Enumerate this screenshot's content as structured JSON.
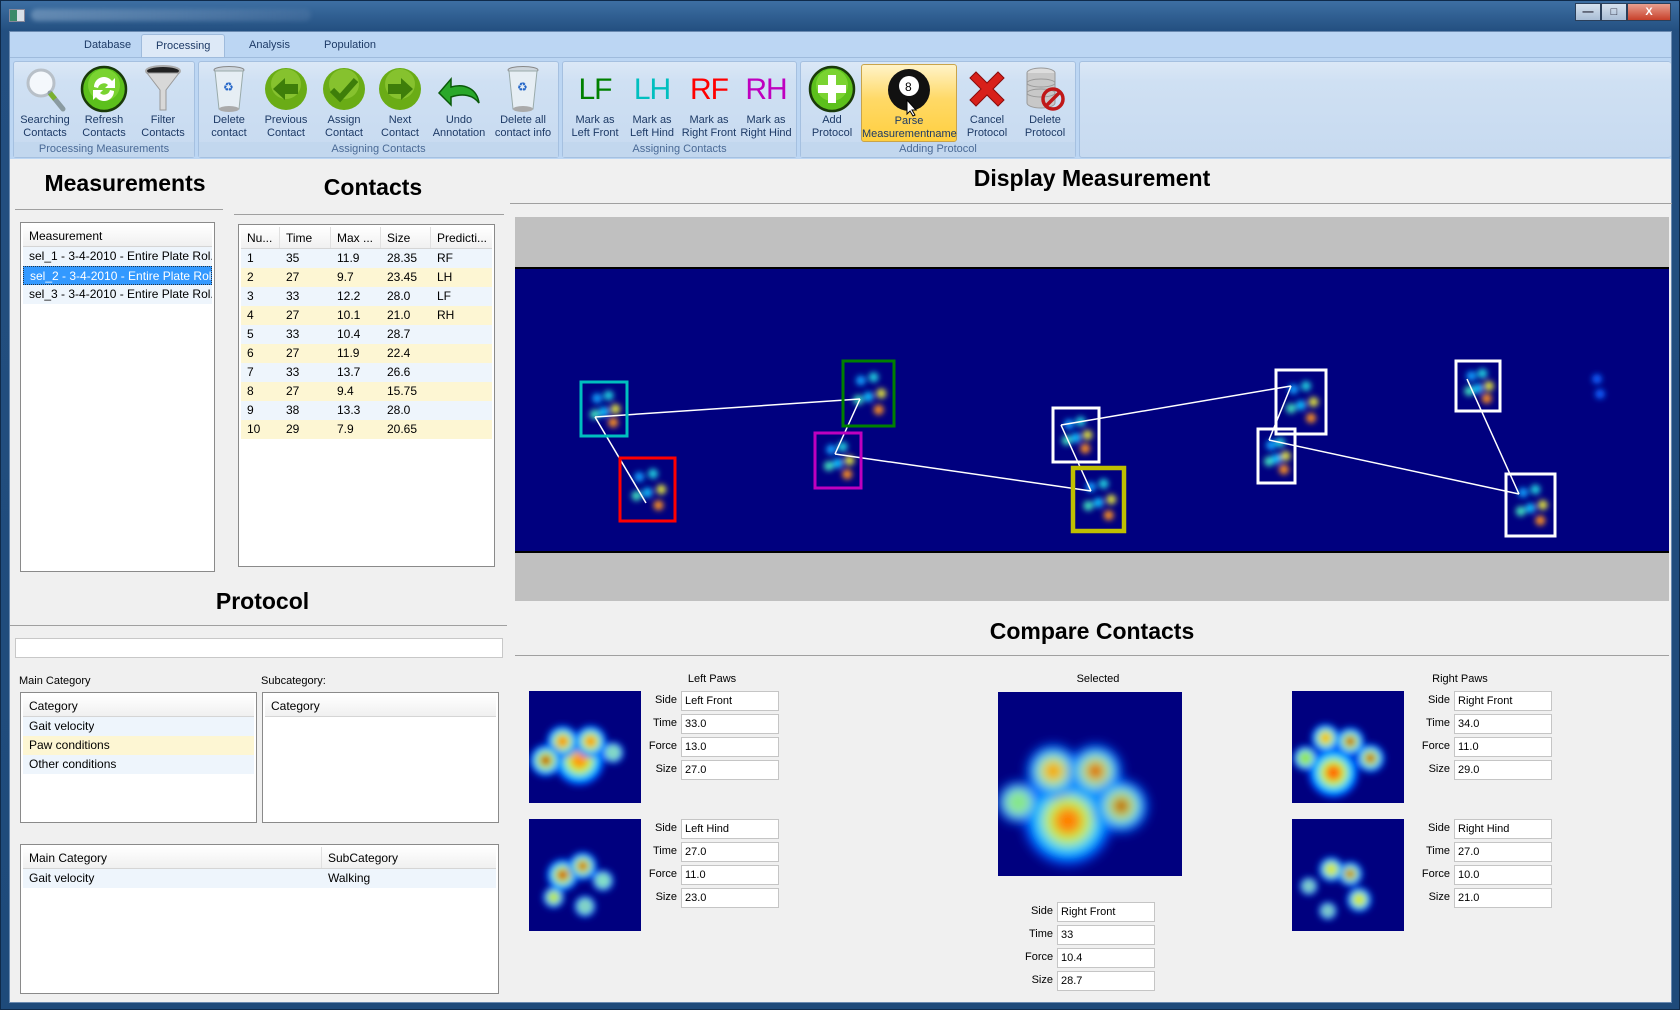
{
  "window": {
    "controls": {
      "minimize": "—",
      "maximize": "□",
      "close": "X"
    }
  },
  "tabs": [
    {
      "label": "Database",
      "active": false
    },
    {
      "label": "Processing",
      "active": true
    },
    {
      "label": "Analysis",
      "active": false
    },
    {
      "label": "Population",
      "active": false
    }
  ],
  "ribbon": {
    "groups": [
      {
        "label": "Processing Measurements",
        "buttons": [
          {
            "label1": "Searching",
            "label2": "Contacts",
            "icon": "search-icon"
          },
          {
            "label1": "Refresh",
            "label2": "Contacts",
            "icon": "refresh-icon"
          },
          {
            "label1": "Filter",
            "label2": "Contacts",
            "icon": "funnel-icon"
          }
        ]
      },
      {
        "label": "Assigning Contacts",
        "buttons": [
          {
            "label1": "Delete",
            "label2": "contact",
            "icon": "recycle-bin-icon"
          },
          {
            "label1": "Previous",
            "label2": "Contact",
            "icon": "arrow-left-icon"
          },
          {
            "label1": "Assign",
            "label2": "Contact",
            "icon": "checkmark-icon"
          },
          {
            "label1": "Next",
            "label2": "Contact",
            "icon": "arrow-right-icon"
          },
          {
            "label1": "Undo",
            "label2": "Annotation",
            "icon": "undo-icon"
          },
          {
            "label1": "Delete all",
            "label2": "contact info",
            "icon": "recycle-bin-icon"
          }
        ]
      },
      {
        "label": "Assigning Contacts",
        "buttons": [
          {
            "glyph": "LF",
            "color": "#008000",
            "label1": "Mark as",
            "label2": "Left Front"
          },
          {
            "glyph": "LH",
            "color": "#00bfbf",
            "label1": "Mark as",
            "label2": "Left Hind"
          },
          {
            "glyph": "RF",
            "color": "#ff0000",
            "label1": "Mark as",
            "label2": "Right Front"
          },
          {
            "glyph": "RH",
            "color": "#bf00bf",
            "label1": "Mark as",
            "label2": "Right Hind"
          }
        ]
      },
      {
        "label": "Adding Protocol",
        "buttons": [
          {
            "label1": "Add",
            "label2": "Protocol",
            "icon": "plus-icon"
          },
          {
            "label1": "Parse",
            "label2": "Measurementname",
            "icon": "eight-ball-icon",
            "hovered": true
          },
          {
            "label1": "Cancel",
            "label2": "Protocol",
            "icon": "red-x-icon"
          },
          {
            "label1": "Delete",
            "label2": "Protocol",
            "icon": "database-delete-icon"
          }
        ]
      }
    ]
  },
  "measurements": {
    "title": "Measurements",
    "column": "Measurement",
    "items": [
      {
        "label": "sel_1 - 3-4-2010 - Entire Plate Rol...",
        "selected": false
      },
      {
        "label": "sel_2 - 3-4-2010 - Entire Plate Rol...",
        "selected": true
      },
      {
        "label": "sel_3 - 3-4-2010 - Entire Plate Rol...",
        "selected": false
      }
    ]
  },
  "contacts": {
    "title": "Contacts",
    "columns": [
      "Nu...",
      "Time",
      "Max ...",
      "Size",
      "Predicti..."
    ],
    "rows": [
      [
        "1",
        "35",
        "11.9",
        "28.35",
        "RF"
      ],
      [
        "2",
        "27",
        "9.7",
        "23.45",
        "LH"
      ],
      [
        "3",
        "33",
        "12.2",
        "28.0",
        "LF"
      ],
      [
        "4",
        "27",
        "10.1",
        "21.0",
        "RH"
      ],
      [
        "5",
        "33",
        "10.4",
        "28.7",
        ""
      ],
      [
        "6",
        "27",
        "11.9",
        "22.4",
        ""
      ],
      [
        "7",
        "33",
        "13.7",
        "26.6",
        ""
      ],
      [
        "8",
        "27",
        "9.4",
        "15.75",
        ""
      ],
      [
        "9",
        "38",
        "13.3",
        "28.0",
        ""
      ],
      [
        "10",
        "29",
        "7.9",
        "20.65",
        ""
      ]
    ]
  },
  "display": {
    "title": "Display Measurement",
    "boxes": [
      {
        "color": "#00bfbf",
        "label": "LH"
      },
      {
        "color": "#ff0000",
        "label": "RF"
      },
      {
        "color": "#008000",
        "label": "LF"
      },
      {
        "color": "#bf00bf",
        "label": "RH"
      },
      {
        "color": "#ffffff",
        "label": ""
      },
      {
        "color": "#bfbf00",
        "label": "selected"
      },
      {
        "color": "#ffffff",
        "label": ""
      },
      {
        "color": "#ffffff",
        "label": ""
      },
      {
        "color": "#ffffff",
        "label": ""
      },
      {
        "color": "#ffffff",
        "label": ""
      }
    ]
  },
  "protocol": {
    "title": "Protocol",
    "input_value": "",
    "main_category_label": "Main Category",
    "subcategory_label": "Subcategory:",
    "category_column": "Category",
    "categories": [
      "Gait velocity",
      "Paw conditions",
      "Other conditions"
    ],
    "subcategory_column": "Category",
    "subcategories": [],
    "assigned_columns": [
      "Main Category",
      "SubCategory"
    ],
    "assigned_rows": [
      [
        "Gait velocity",
        "Walking"
      ]
    ]
  },
  "compare": {
    "title": "Compare Contacts",
    "field_labels": {
      "side": "Side",
      "time": "Time",
      "force": "Force",
      "size": "Size"
    },
    "left_caption": "Left Paws",
    "right_caption": "Right Paws",
    "selected_caption": "Selected",
    "left_front": {
      "side": "Left Front",
      "time": "33.0",
      "force": "13.0",
      "size": "27.0"
    },
    "left_hind": {
      "side": "Left Hind",
      "time": "27.0",
      "force": "11.0",
      "size": "23.0"
    },
    "right_front": {
      "side": "Right Front",
      "time": "34.0",
      "force": "11.0",
      "size": "29.0"
    },
    "right_hind": {
      "side": "Right Hind",
      "time": "27.0",
      "force": "10.0",
      "size": "21.0"
    },
    "selected": {
      "side": "Right Front",
      "time": "33",
      "force": "10.4",
      "size": "28.7"
    }
  }
}
